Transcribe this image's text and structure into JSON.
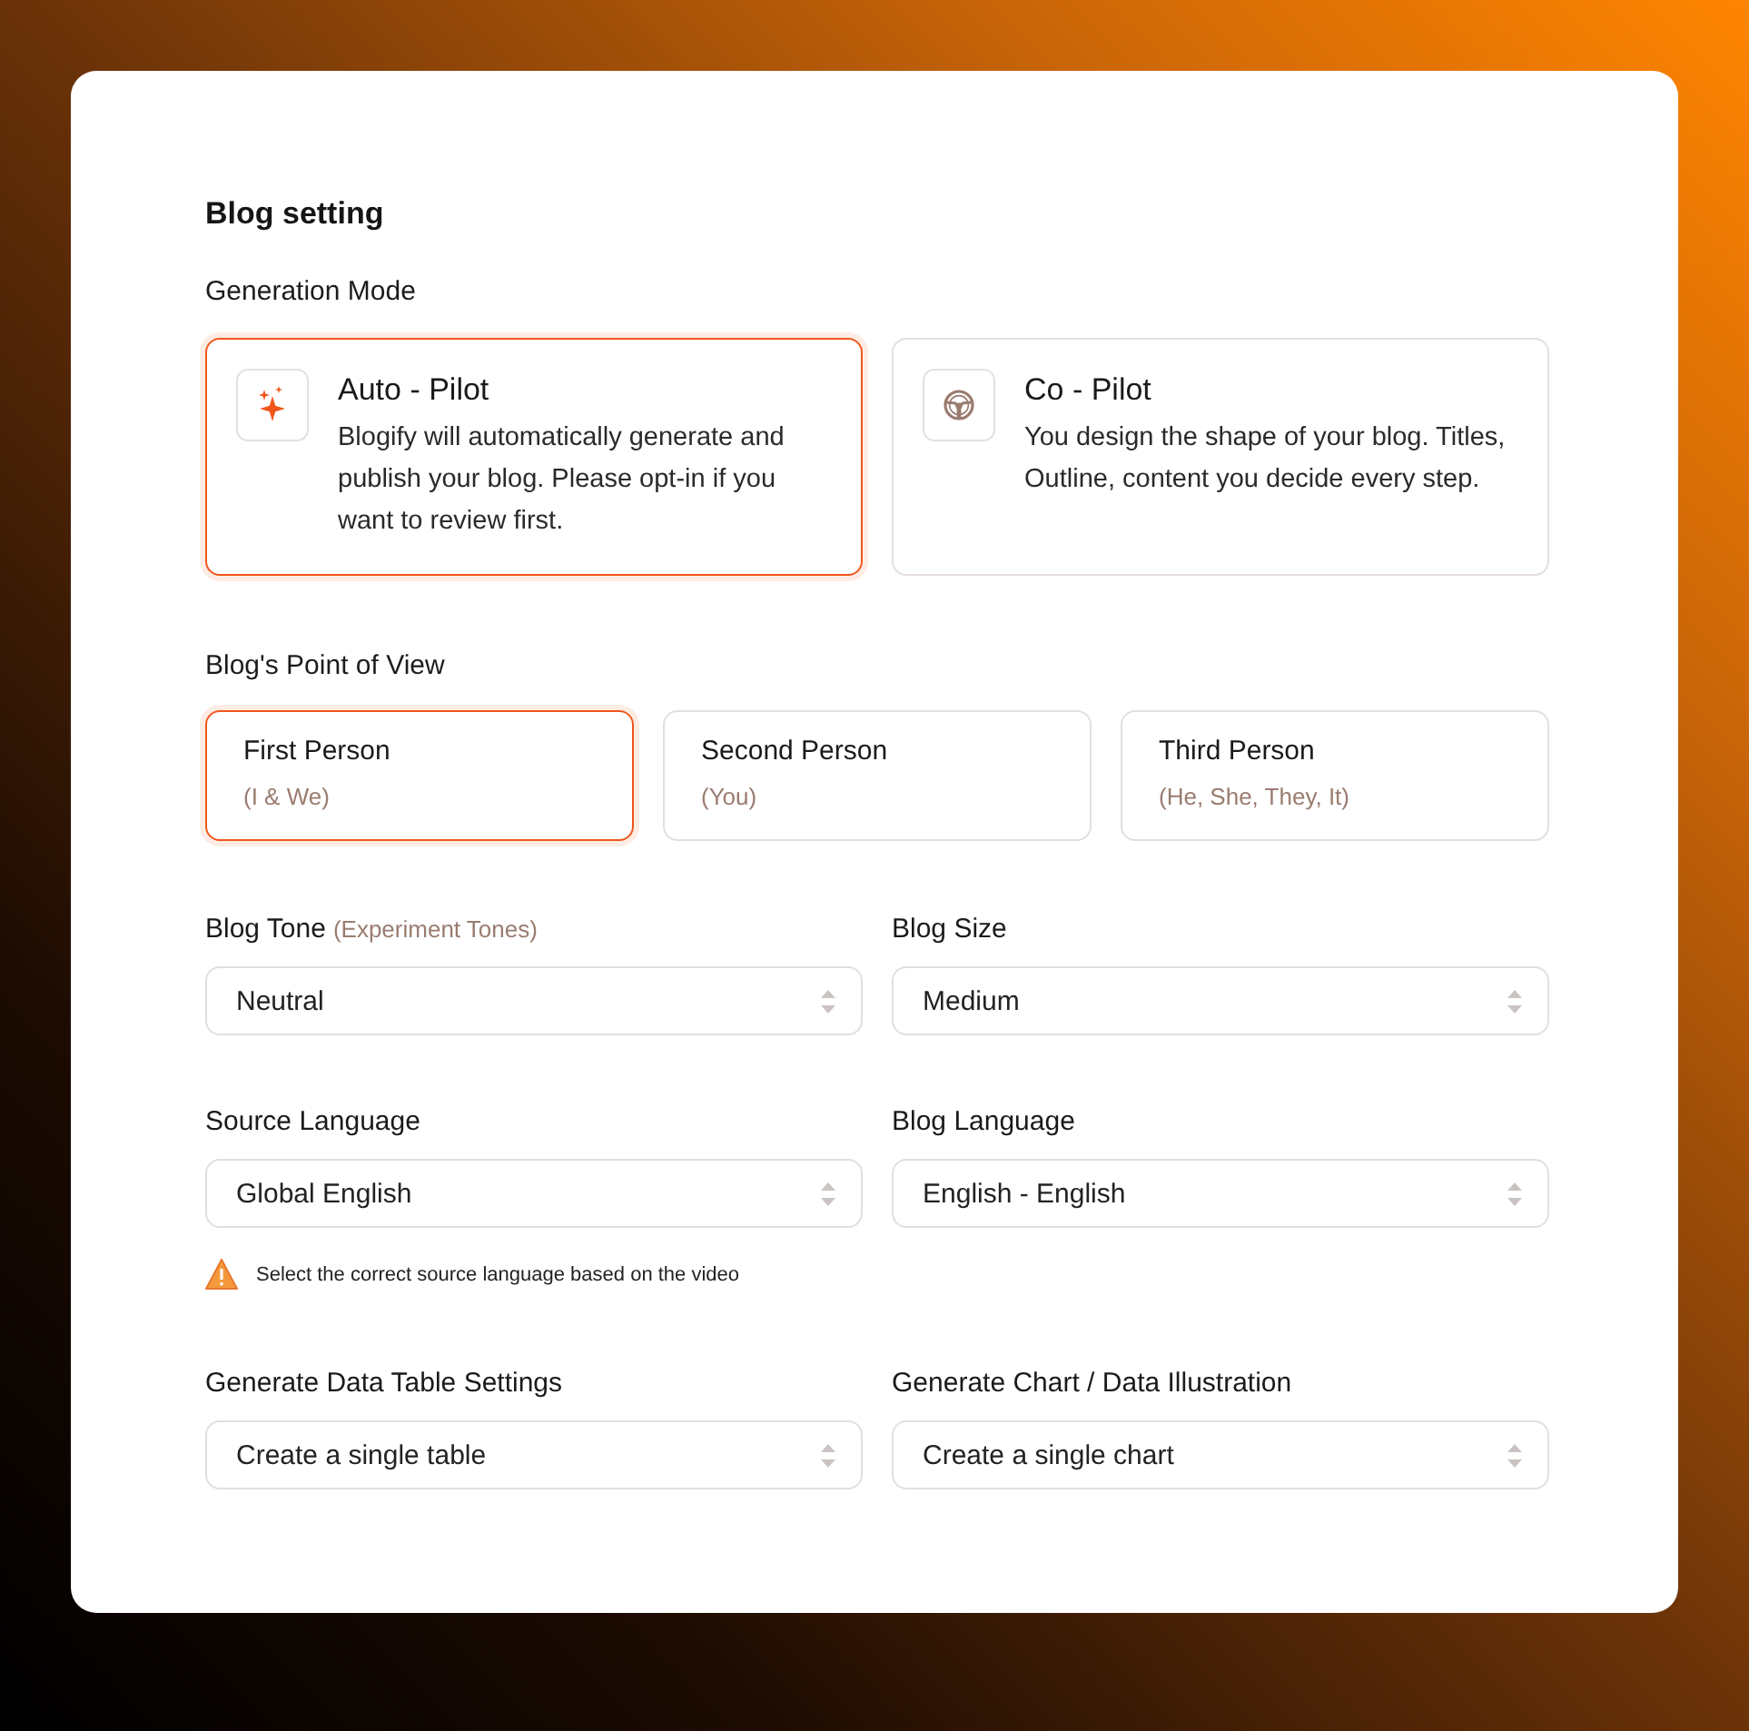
{
  "title": "Blog setting",
  "generation_mode": {
    "label": "Generation Mode",
    "options": [
      {
        "kind": "auto",
        "title": "Auto - Pilot",
        "description": "Blogify will automatically generate and publish your blog. Please opt-in if you want to review first.",
        "selected": true
      },
      {
        "kind": "co",
        "title": "Co - Pilot",
        "description": "You design the shape of your blog. Titles, Outline, content you decide every step.",
        "selected": false
      }
    ]
  },
  "point_of_view": {
    "label": "Blog's Point of View",
    "options": [
      {
        "title": "First Person",
        "subtitle": "(I & We)",
        "selected": true
      },
      {
        "title": "Second Person",
        "subtitle": "(You)",
        "selected": false
      },
      {
        "title": "Third Person",
        "subtitle": "(He, She, They, It)",
        "selected": false
      }
    ]
  },
  "fields": [
    {
      "label": "Blog Tone",
      "hint": "(Experiment Tones)",
      "value": "Neutral"
    },
    {
      "label": "Blog Size",
      "value": "Medium"
    },
    {
      "label": "Source Language",
      "value": "Global English",
      "note": "Select the correct source language based on the video"
    },
    {
      "label": "Blog Language",
      "value": "English - English"
    },
    {
      "label": "Generate Data Table Settings",
      "value": "Create a single table"
    },
    {
      "label": "Generate Chart / Data Illustration",
      "value": "Create a single chart"
    }
  ]
}
